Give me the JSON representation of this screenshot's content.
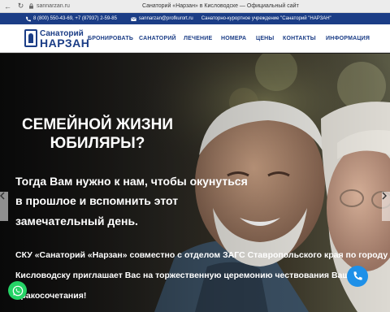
{
  "browser": {
    "url": "sannarzan.ru",
    "page_title": "Санаторий «Нарзан» в Кисловодске — Официальный сайт"
  },
  "topbar": {
    "phones": "8 (800) 550-43-69, +7 (87937) 2-59-85",
    "email": "sannarzan@profkurort.ru",
    "org": "Санаторно-курортное учреждение \"Санаторий \"НАРЗАН\""
  },
  "logo": {
    "line1": "Санаторий",
    "line2": "НАРЗАН"
  },
  "nav": {
    "items": [
      "БРОНИРОВАТЬ",
      "САНАТОРИЙ",
      "ЛЕЧЕНИЕ",
      "НОМЕРА",
      "ЦЕНЫ",
      "КОНТАКТЫ",
      "ИНФОРМАЦИЯ"
    ]
  },
  "hero": {
    "title_line1": "СЕМЕЙНОЙ ЖИЗНИ",
    "title_line2": "ЮБИЛЯРЫ?",
    "sub_line1": "Тогда Вам нужно к нам, чтобы окунуться",
    "sub_line2": "в прошлое и вспомнить этот",
    "sub_line3": "замечательный день.",
    "body_line1": "СКУ «Санаторий «Нарзан» совместно с отделом ЗАГС Ставропольского края по городу",
    "body_line2": "Кисловодску приглашает Вас на торжественную церемонию чествования Вашего",
    "body_line3": "бракосочетания!"
  },
  "icons": {
    "prev": "chevron-left-icon",
    "next": "chevron-right-icon",
    "whatsapp": "whatsapp-icon",
    "call": "phone-icon"
  },
  "colors": {
    "brand_blue": "#1b3d86",
    "whatsapp_green": "#25d366",
    "call_blue": "#1e90e8"
  }
}
